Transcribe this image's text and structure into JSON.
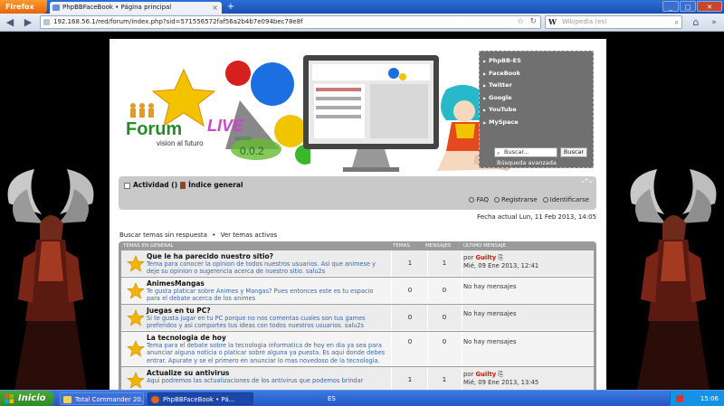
{
  "browser": {
    "menu_button": "Firefox",
    "tab_title": "PhpBBFaceBook • Página principal",
    "tab_close": "×",
    "new_tab": "+",
    "url": "192.168.56.1/red/forum/index.php?sid=571556572faf56a2b4b7e094bec78e8f",
    "search_engine_letter": "W",
    "search_placeholder": "Wikipedia (es)"
  },
  "banner": {
    "logo_word1": "Forum",
    "logo_word2": "LIVE",
    "logo_tagline": "vision al futuro",
    "version_label": "version",
    "version_number": "0.0.2",
    "links": [
      "PhpBB-ES",
      "FaceBook",
      "Twitter",
      "Google",
      "YouTube",
      "MySpace"
    ],
    "search_placeholder": "Buscar...",
    "search_button": "Buscar",
    "advanced_search": "Búsqueda avanzada"
  },
  "navbar": {
    "activity": "Actividad ()",
    "index": "Índice general",
    "toggle": "-^-",
    "faq": "FAQ",
    "register": "Registrarse",
    "login": "Identificarse"
  },
  "date_line": "Fecha actual Lun, 11 Feb 2013, 14:05",
  "quick_links": {
    "unanswered": "Buscar temas sin respuesta",
    "separator": "•",
    "active": "Ver temas activos"
  },
  "forum_table": {
    "header": {
      "forum": "TEMAS EN GENERAL",
      "topics": "TEMAS",
      "posts": "MENSAJES",
      "last_post": "ÚLTIMO MENSAJE"
    },
    "rows": [
      {
        "title": "Que le ha parecido nuestro sitio?",
        "desc": "Tema para conocer la opinion de todos nuestros usuarios. Asi que animese y deje su opinion o sugerencia acerca de nuestro sitio. salu2s",
        "topics": "1",
        "posts": "1",
        "by": "por",
        "author": "Guilty",
        "date": "Mié, 09 Ene 2013, 12:41"
      },
      {
        "title": "AnimesMangas",
        "desc": "Te gusta platicar sobre Animes y Mangas? Pues entonces este es tu espacio para el debate acerca de los animes",
        "topics": "0",
        "posts": "0",
        "no_posts": "No hay mensajes"
      },
      {
        "title": "Juegas en tu PC?",
        "desc": "Si te gusta jugar en tu PC porque no nos comentas cuales son tus games preferidos y asi compartes tus ideas con todos nuestros usuarios. salu2s",
        "topics": "0",
        "posts": "0",
        "no_posts": "No hay mensajes"
      },
      {
        "title": "La tecnologia de hoy",
        "desc": "Tema para el debate sobre la tecnologia informatica de hoy en dia ya sea para anunciar alguna noticia o platicar sobre alguna ya puesta. Es aqui donde debes entrar. Apurate y se el primero en anunciar lo mas novedoso de la tecnologia.",
        "topics": "0",
        "posts": "0",
        "no_posts": "No hay mensajes"
      },
      {
        "title": "Actualize su antivirus",
        "desc": "Aqui podremos las actualizaciones de los antivirus que podemos brindar",
        "topics": "1",
        "posts": "1",
        "by": "por",
        "author": "Guilty",
        "date": "Mié, 09 Ene 2013, 13:45"
      }
    ]
  },
  "taskbar": {
    "start": "Inicio",
    "task1": "Total Commander 20....",
    "task2": "PhpBBFaceBook • Pá...",
    "language": "ES",
    "clock": "15:06"
  },
  "colors": {
    "accent_blue": "#3b67a8",
    "author_red": "#b21111",
    "panel_gray": "#707070"
  }
}
